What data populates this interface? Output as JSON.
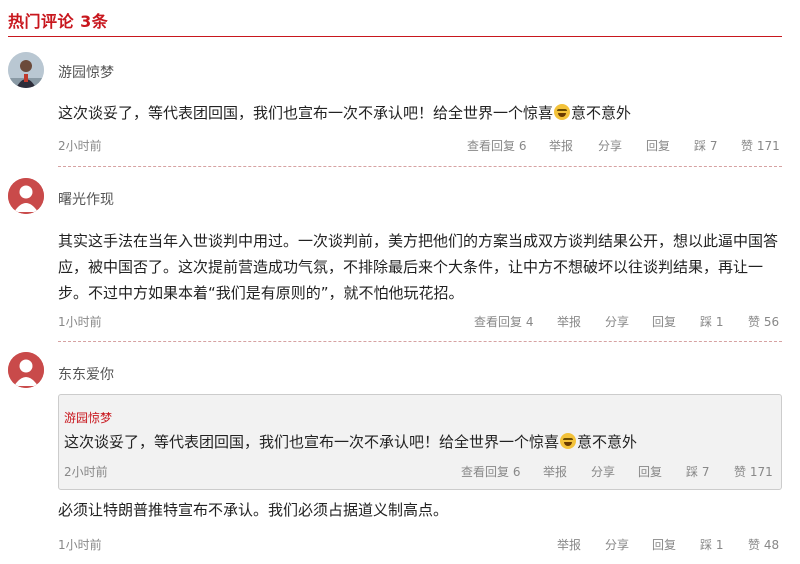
{
  "header": {
    "title": "热门评论 3条",
    "accent_color": "#c8171e"
  },
  "comments": [
    {
      "username": "游园惊梦",
      "avatar": "photo-avatar",
      "text_before_emoji": "这次谈妥了，等代表团回国，我们也宣布一次不承认吧！给全世界一个惊喜",
      "emoji": "laughing-emoji",
      "text_after_emoji": "意不意外",
      "time": "2小时前",
      "view_replies": "查看回复 6",
      "report": "举报",
      "share": "分享",
      "reply": "回复",
      "dislike_label": "踩",
      "dislike_count": "7",
      "like_label": "赞",
      "like_count": "171"
    },
    {
      "username": "曙光作现",
      "avatar": "default-avatar",
      "text": "其实这手法在当年入世谈判中用过。一次谈判前，美方把他们的方案当成双方谈判结果公开，想以此逼中国答应，被中国否了。这次提前营造成功气氛，不排除最后来个大条件，让中方不想破坏以往谈判结果，再让一步。不过中方如果本着“我们是有原则的”，就不怕他玩花招。",
      "time": "1小时前",
      "view_replies": "查看回复 4",
      "report": "举报",
      "share": "分享",
      "reply": "回复",
      "dislike_label": "踩",
      "dislike_count": "1",
      "like_label": "赞",
      "like_count": "56"
    },
    {
      "username": "东东爱你",
      "avatar": "default-avatar",
      "quote": {
        "username": "游园惊梦",
        "text_before_emoji": "这次谈妥了，等代表团回国，我们也宣布一次不承认吧！给全世界一个惊喜",
        "emoji": "laughing-emoji",
        "text_after_emoji": "意不意外",
        "time": "2小时前",
        "view_replies": "查看回复 6",
        "report": "举报",
        "share": "分享",
        "reply": "回复",
        "dislike_label": "踩",
        "dislike_count": "7",
        "like_label": "赞",
        "like_count": "171"
      },
      "text": "必须让特朗普推特宣布不承认。我们必须占据道义制高点。",
      "time": "1小时前",
      "report": "举报",
      "share": "分享",
      "reply": "回复",
      "dislike_label": "踩",
      "dislike_count": "1",
      "like_label": "赞",
      "like_count": "48"
    }
  ]
}
